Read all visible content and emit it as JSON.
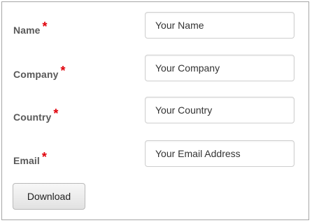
{
  "form": {
    "required_marker": "*",
    "fields": [
      {
        "label": "Name",
        "placeholder": "Your Name"
      },
      {
        "label": "Company",
        "placeholder": "Your Company"
      },
      {
        "label": "Country",
        "placeholder": "Your Country"
      },
      {
        "label": "Email",
        "placeholder": "Your Email Address"
      }
    ],
    "submit_label": "Download"
  },
  "colors": {
    "required_marker": "#e0000a",
    "label_text": "#595959",
    "frame_border": "#a6a6a6"
  }
}
